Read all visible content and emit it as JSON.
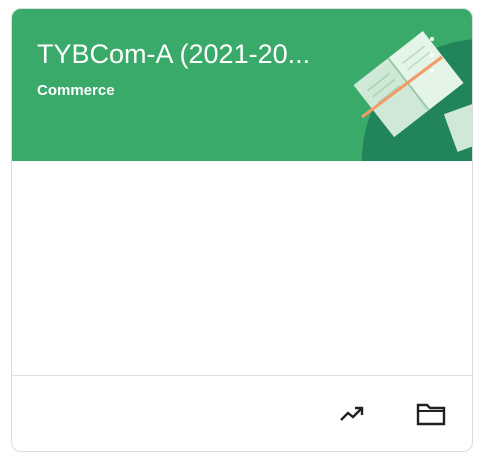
{
  "card": {
    "title": "TYBCom-A (2021-20...",
    "section": "Commerce",
    "colors": {
      "header": "#3aaa6b",
      "header_dark": "#21845a",
      "icon": "#202124"
    },
    "icons": {
      "more": "more-vert-icon",
      "gradebook": "trending-up-icon",
      "folder": "folder-icon"
    }
  }
}
